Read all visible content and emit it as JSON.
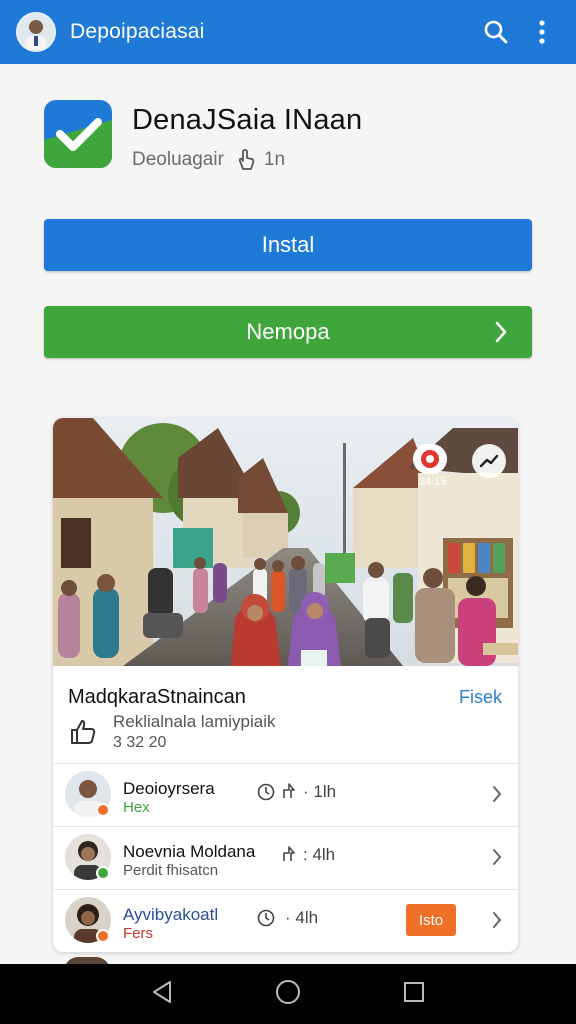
{
  "appbar": {
    "title": "Depoipaciasai",
    "search_icon": "search-icon",
    "menu_icon": "more-vert-icon",
    "color": "#1e7ad6"
  },
  "app": {
    "name": "DenaJSaia INaan",
    "developer": "Deoluagair",
    "meta_value": "1n",
    "icon": "checkmark-app-icon"
  },
  "buttons": {
    "install_label": "Instal",
    "open_label": "Nemopa",
    "install_color": "#1e7ad6",
    "open_color": "#3ea63a"
  },
  "card": {
    "photo_count": "24 15",
    "title": "MadqkaraStnaincan",
    "link": "Fisek",
    "subtitle": "Reklialnala lamiypiaik",
    "number": "3 32 20",
    "rows": [
      {
        "name": "Deoioyrsera",
        "sub": "Hex",
        "sub_color": "#3ea63a",
        "time": "· 1lh",
        "dot_color": "#f07028"
      },
      {
        "name": "Noevnia Moldana",
        "sub": "Perdit fhisatcn",
        "sub_color": "#555555",
        "time": ": 4lh",
        "dot_color": "#3ea63a"
      },
      {
        "name": "Ayvibyakoatl",
        "sub": "Fers",
        "sub_color": "#c0392b",
        "time": "· 4lh",
        "dot_color": "#f07028",
        "tag": "Isto"
      }
    ]
  },
  "navbar": {
    "back_icon": "back-triangle-icon",
    "home_icon": "home-circle-icon",
    "recents_icon": "recents-square-icon"
  }
}
